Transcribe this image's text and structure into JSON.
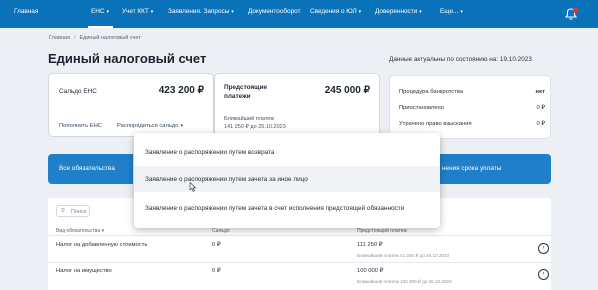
{
  "nav": {
    "items": [
      "Главная",
      "ЕНС",
      "Учет ККТ",
      "Заявления. Запросы",
      "Документооборот",
      "Сведения о ЮЛ",
      "Доверенности",
      "Еще..."
    ],
    "active": "ЕНС",
    "accent": "#0a72b8"
  },
  "breadcrumb": [
    "Главная",
    "Единый налоговый счет"
  ],
  "page": {
    "title": "Единый налоговый счет",
    "actual_date": "Данные актуальны по состоянию на: 19.10.2023"
  },
  "saldo_card": {
    "label": "Сальдо ЕНС",
    "amount": "423 200 ₽",
    "link_replenish": "Пополнить ЕНС",
    "link_dispose": "Распорядиться сальдо"
  },
  "upcoming_card": {
    "label_line1": "Предстоящие",
    "label_line2": "платежи",
    "amount": "245 000 ₽",
    "note_line1": "Ближайший платеж",
    "note_line2": "141 250 ₽ до 25.10.2023"
  },
  "bankruptcy_card": {
    "rows": [
      {
        "label": "Процедура банкротства",
        "value": "нет"
      },
      {
        "label": "Приостановлено",
        "value": "0 ₽"
      },
      {
        "label": "Утрачено право взыскания",
        "value": "0 ₽"
      }
    ]
  },
  "tabs": {
    "all_obligations": "Все обязательства",
    "deadline": "нения срока уплаты"
  },
  "dropdown": {
    "items": [
      "Заявление о распоряжении путем возврата",
      "Заявление о распоряжении путем зачета за иное лицо",
      "Заявление о распоряжении путем зачета в счет исполнения предстоящей обязанности"
    ]
  },
  "table": {
    "search_placeholder": "Поиск",
    "headers": [
      "Вид обязательства",
      "Сальдо",
      "Предстоящий платеж"
    ],
    "rows": [
      {
        "name": "Налог на добавленную стоимость",
        "saldo": "0 ₽",
        "upcoming": "111 250 ₽",
        "sub": "Ближайший платеж 41 250 ₽ до 25.10.2023"
      },
      {
        "name": "Налог на имущество",
        "saldo": "0 ₽",
        "upcoming": "100 000 ₽",
        "sub": "Ближайший платеж 100 000 ₽ до 25.10.2023"
      }
    ]
  }
}
